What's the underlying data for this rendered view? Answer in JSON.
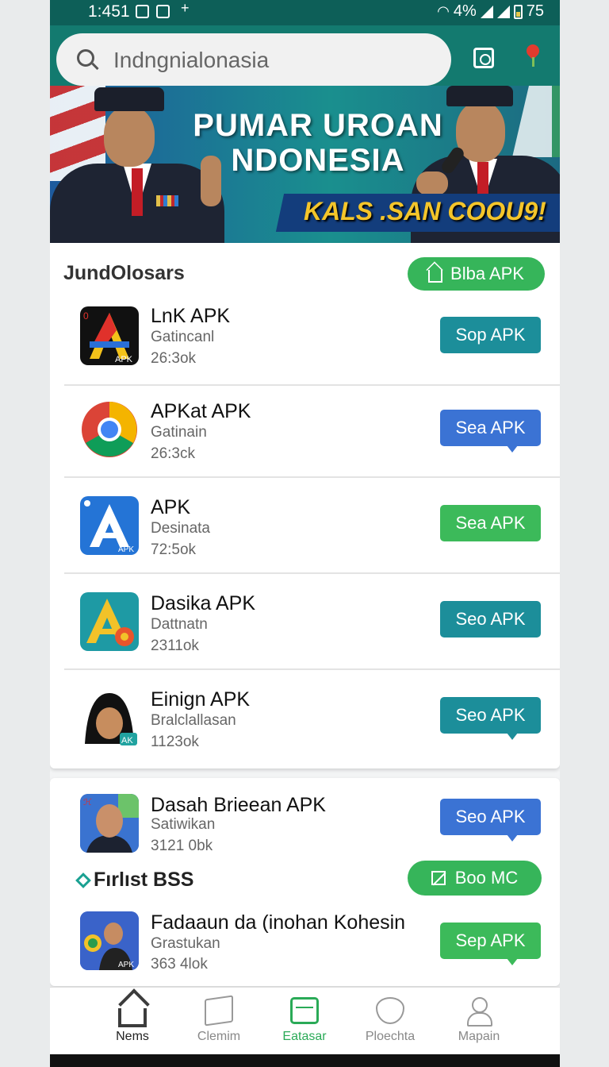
{
  "status_bar": {
    "time": "1:451",
    "plus": "+",
    "battery_text": "4%",
    "battery_level": "75"
  },
  "search": {
    "placeholder": "Indngnialonasia"
  },
  "header_icons": [
    "scan-icon",
    "location-pin-icon"
  ],
  "banner": {
    "title_line1": "PUMAR UROAN",
    "title_line2": "NDONESIA",
    "subtitle": "KALS .SAN COOU9!"
  },
  "section1": {
    "title": "JundOlosars",
    "button_label": "Blba APK",
    "apps": [
      {
        "name": "LnK APK",
        "category": "Gatincanl",
        "size": "26:3ok",
        "button": "Sop APK",
        "color": "teal"
      },
      {
        "name": "APKat APK",
        "category": "Gatinain",
        "size": "26:3ck",
        "button": "Sea APK",
        "color": "blue"
      },
      {
        "name": "APK",
        "category": "Desinata",
        "size": "72:5ok",
        "button": "Sea APK",
        "color": "green"
      },
      {
        "name": "Dasika APK",
        "category": "Dattnatn",
        "size": "2311ok",
        "button": "Seo APK",
        "color": "teal"
      },
      {
        "name": "Einign APK",
        "category": "Bralclallasan",
        "size": "1123ok",
        "button": "Seo APK",
        "color": "teal"
      }
    ]
  },
  "section2": {
    "app_top": {
      "name": "Dasah Brieean APK",
      "category": "Satiwikan",
      "size": "3121 0bk",
      "button": "Seo APK"
    },
    "title": "Fırlıst BSS",
    "button_label": "Boo MC",
    "app_bottom": {
      "name": "Fadaaun da (inohan Kohesin",
      "category": "Grastukan",
      "size": "363 4lok",
      "button": "Sep APK"
    }
  },
  "bottom_nav": [
    {
      "label": "Nems",
      "icon": "home-icon",
      "active": true
    },
    {
      "label": "Clemim",
      "icon": "document-icon",
      "active": false
    },
    {
      "label": "Eatasar",
      "icon": "box-icon",
      "active": true
    },
    {
      "label": "Ploechta",
      "icon": "shield-icon",
      "active": false
    },
    {
      "label": "Mapain",
      "icon": "user-icon",
      "active": false
    }
  ],
  "colors": {
    "header": "#137a6f",
    "teal": "#1c8e9a",
    "blue": "#3b73d4",
    "green": "#3cba5a"
  }
}
